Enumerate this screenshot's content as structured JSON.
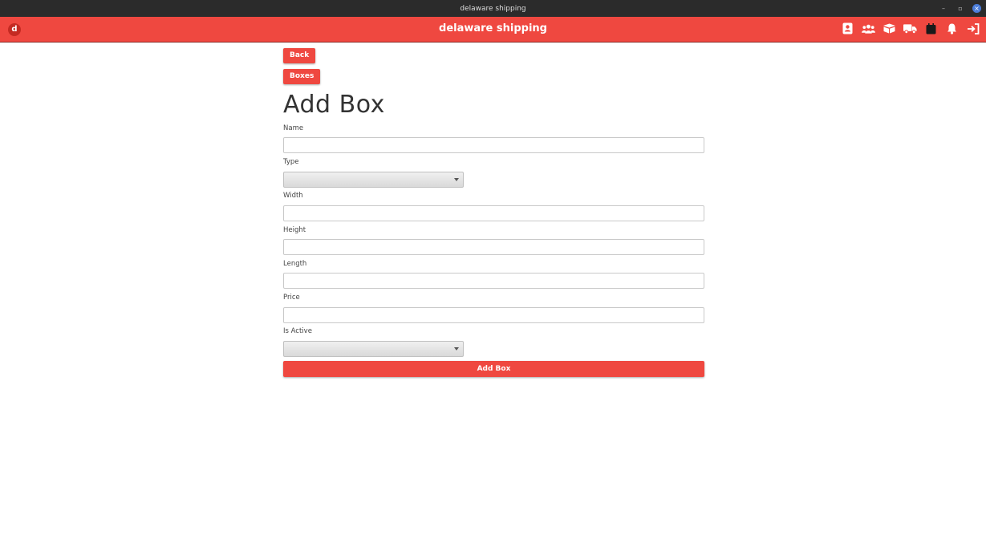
{
  "window": {
    "title": "delaware shipping"
  },
  "navbar": {
    "logo_letter": "d",
    "title": "delaware shipping",
    "accent_color": "#ef4840",
    "icons": [
      "contact-card-icon",
      "users-icon",
      "boxes-icon",
      "truck-icon",
      "calendar-icon",
      "bell-icon",
      "logout-icon"
    ]
  },
  "page": {
    "back_label": "Back",
    "boxes_label": "Boxes",
    "title": "Add Box"
  },
  "form": {
    "name_label": "Name",
    "name_value": "",
    "type_label": "Type",
    "type_value": "",
    "width_label": "Width",
    "width_value": "",
    "height_label": "Height",
    "height_value": "",
    "length_label": "Length",
    "length_value": "",
    "price_label": "Price",
    "price_value": "",
    "active_label": "Is Active",
    "active_value": "",
    "submit_label": "Add Box"
  }
}
